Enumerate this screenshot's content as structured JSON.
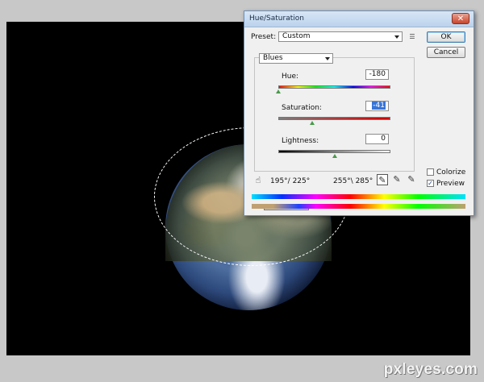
{
  "dialog": {
    "title": "Hue/Saturation",
    "close_label": "✕",
    "preset_label": "Preset:",
    "preset_value": "Custom",
    "ok_label": "OK",
    "cancel_label": "Cancel",
    "channel_value": "Blues",
    "hue": {
      "label": "Hue:",
      "value": "-180",
      "level": 0.0
    },
    "saturation": {
      "label": "Saturation:",
      "value": "-41",
      "level": 0.3
    },
    "lightness": {
      "label": "Lightness:",
      "value": "0",
      "level": 0.5
    },
    "range_left": "195°/ 225°",
    "range_right": "255°\\ 285°",
    "colorize": {
      "label": "Colorize",
      "checked": false
    },
    "preview": {
      "label": "Preview",
      "checked": true
    }
  },
  "watermark": "pxleyes.com",
  "colors": {
    "canvas_bg": "#000000",
    "app_bg": "#c8c8c8",
    "dialog_bg": "#f0f0f0",
    "titlebar": "#c9dcf1",
    "close_button": "#c9452c",
    "selection": "#ffffff"
  },
  "icons": {
    "preset_menu": "list-menu-icon",
    "hand_tool": "hand-adjust-icon",
    "eyedroppers": [
      "eyedropper-icon",
      "eyedropper-plus-icon",
      "eyedropper-minus-icon"
    ]
  }
}
